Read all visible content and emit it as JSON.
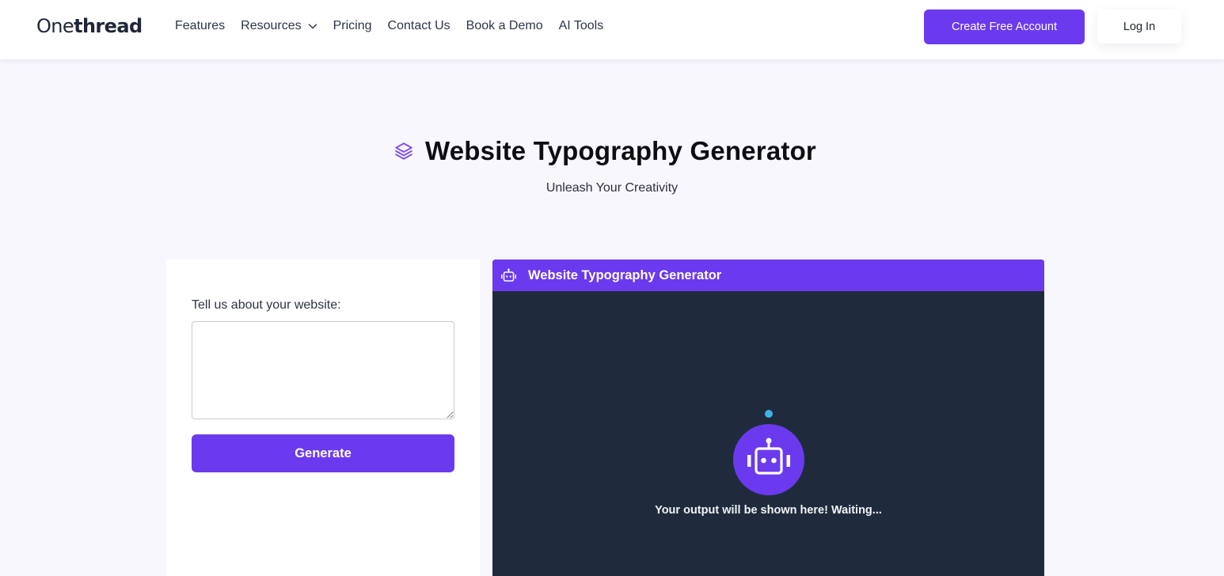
{
  "navbar": {
    "logo": {
      "light": "One",
      "bold": "thread"
    },
    "links": [
      {
        "label": "Features"
      },
      {
        "label": "Resources",
        "has_dropdown": true
      },
      {
        "label": "Pricing"
      },
      {
        "label": "Contact Us"
      },
      {
        "label": "Book a Demo"
      },
      {
        "label": "AI Tools"
      }
    ],
    "create_account_label": "Create Free Account",
    "login_label": "Log In"
  },
  "hero": {
    "icon": "layers-icon",
    "title": "Website Typography Generator",
    "subtitle": "Unleash Your Creativity"
  },
  "form": {
    "label": "Tell us about your website:",
    "textarea_value": "",
    "textarea_placeholder": "",
    "generate_label": "Generate"
  },
  "output": {
    "header_icon": "robot-icon",
    "header_title": "Website Typography Generator",
    "message": "Your output will be shown here! Waiting..."
  },
  "colors": {
    "accent": "#6b3aee",
    "panel_bg": "#1f2b3d",
    "page_bg": "#f9f7fe",
    "status_dot": "#3eb4e6"
  }
}
